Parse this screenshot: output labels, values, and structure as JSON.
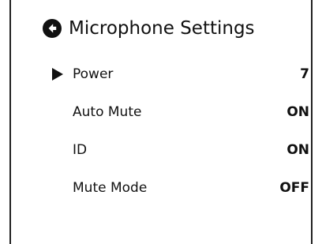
{
  "header": {
    "title": "Microphone Settings",
    "back_icon": "back-arrow-circle-icon"
  },
  "menu": {
    "selected_index": 0,
    "items": [
      {
        "label": "Power",
        "value": "7"
      },
      {
        "label": "Auto Mute",
        "value": "ON"
      },
      {
        "label": "ID",
        "value": "ON"
      },
      {
        "label": "Mute Mode",
        "value": "OFF"
      }
    ]
  },
  "colors": {
    "text": "#111111",
    "background": "#ffffff",
    "frame": "#222222"
  }
}
